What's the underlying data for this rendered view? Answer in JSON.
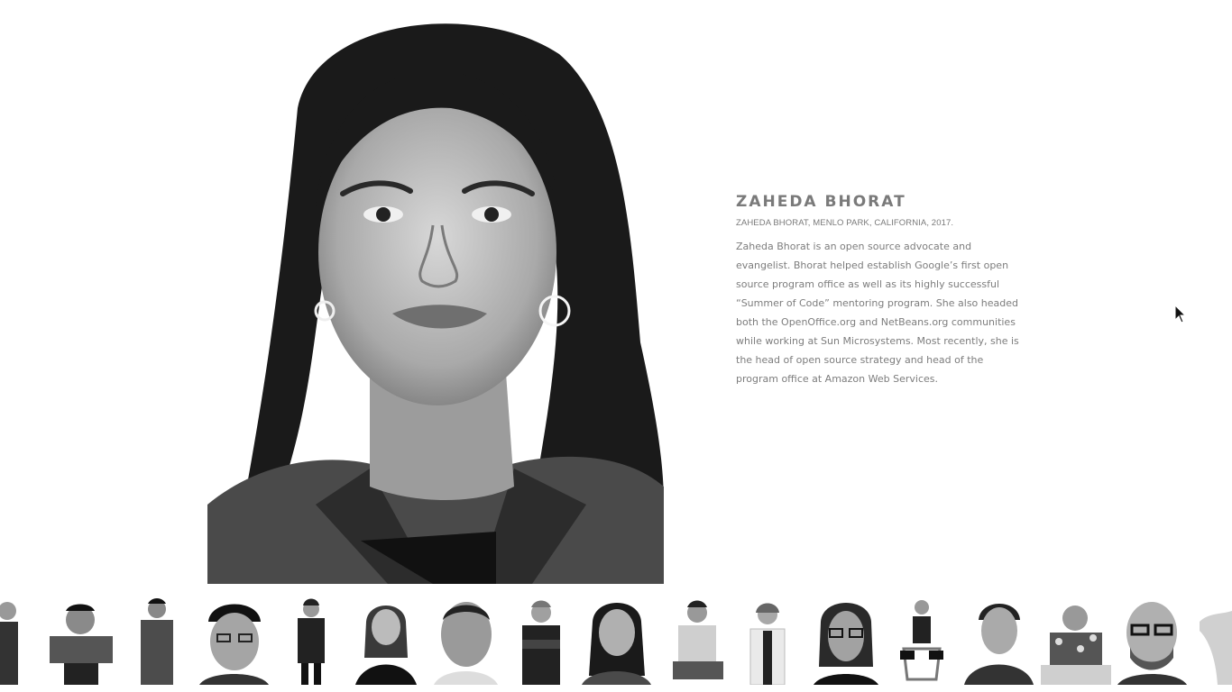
{
  "profile": {
    "name": "ZAHEDA BHORAT",
    "caption": "ZAHEDA BHORAT, MENLO PARK, CALIFORNIA, 2017.",
    "bio": "Zaheda Bhorat is an open source advocate and evangelist. Bhorat helped establish Google’s first open source program office as well as its highly successful “Summer of Code” mentoring program. She also headed both the OpenOffice.org and NetBeans.org communities while working at Sun Microsystems. Most recently, she is the head of open source strategy and head of the program office at Amazon Web Services."
  },
  "gallery": {
    "thumbnails": [
      {
        "subject": "person-partial-left"
      },
      {
        "subject": "man-plaid-shirt-arms-crossed"
      },
      {
        "subject": "man-sweater-standing"
      },
      {
        "subject": "man-ny-cap-glasses"
      },
      {
        "subject": "woman-dark-outfit-standing"
      },
      {
        "subject": "woman-hand-on-chin"
      },
      {
        "subject": "older-man-closeup"
      },
      {
        "subject": "man-arms-crossed-dark"
      },
      {
        "subject": "zaheda-bhorat-selected"
      },
      {
        "subject": "man-sitting-crouched"
      },
      {
        "subject": "woman-white-blazer"
      },
      {
        "subject": "man-glasses-long-hair"
      },
      {
        "subject": "woman-sitting-on-chair"
      },
      {
        "subject": "woman-short-hair-scarf"
      },
      {
        "subject": "man-floral-shirt-table"
      },
      {
        "subject": "bald-man-glasses-beard"
      },
      {
        "subject": "person-partial-right"
      }
    ]
  },
  "colors": {
    "background": "#ffffff",
    "text": "#7a7a7a"
  }
}
